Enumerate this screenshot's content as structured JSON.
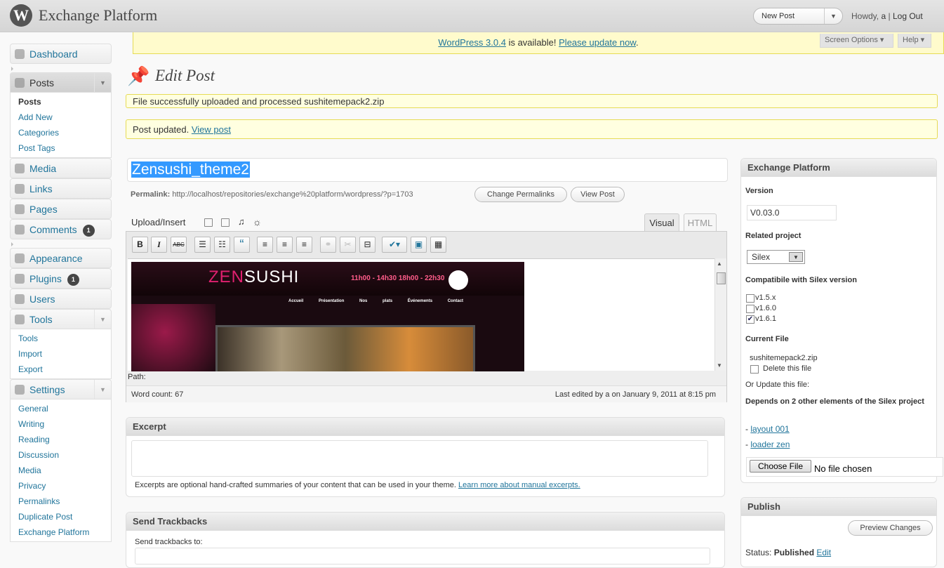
{
  "header": {
    "site_title": "Exchange Platform",
    "new_post": "New Post",
    "howdy_prefix": "Howdy,",
    "user": "a",
    "separator": "|",
    "logout": "Log Out"
  },
  "update_nag": {
    "version_link": "WordPress 3.0.4",
    "middle": "is available!",
    "update_link": "Please update now",
    "end": "."
  },
  "screen_options": "Screen Options",
  "help": "Help",
  "menu": {
    "dashboard": "Dashboard",
    "posts": "Posts",
    "posts_sub": [
      "Posts",
      "Add New",
      "Categories",
      "Post Tags"
    ],
    "media": "Media",
    "links": "Links",
    "pages": "Pages",
    "comments": "Comments",
    "comments_count": "1",
    "appearance": "Appearance",
    "plugins": "Plugins",
    "plugins_count": "1",
    "users": "Users",
    "tools": "Tools",
    "tools_sub": [
      "Tools",
      "Import",
      "Export"
    ],
    "settings": "Settings",
    "settings_sub": [
      "General",
      "Writing",
      "Reading",
      "Discussion",
      "Media",
      "Privacy",
      "Permalinks",
      "Duplicate Post",
      "Exchange Platform"
    ]
  },
  "page_title": "Edit Post",
  "notices": {
    "upload": "File successfully uploaded and processed sushitemepack2.zip",
    "updated": "Post updated.",
    "view_post": "View post"
  },
  "post": {
    "title": "Zensushi_theme2",
    "permalink_label": "Permalink:",
    "permalink_url": "http://localhost/repositories/exchange%20platform/wordpress/?p=1703",
    "change_permalinks": "Change Permalinks",
    "view_post": "View Post"
  },
  "editor": {
    "upload_insert": "Upload/Insert",
    "tab_visual": "Visual",
    "tab_html": "HTML",
    "path": "Path:",
    "word_count": "Word count: 67",
    "last_edited": "Last edited by a on January 9, 2011 at 8:15 pm",
    "toolbar": {
      "bold": "B",
      "italic": "I",
      "strike": "ABC",
      "quote": "“"
    }
  },
  "embedded_image": {
    "logo_a": "ZEN",
    "logo_b": "SUSHI",
    "hours": "11h00 - 14h30   18h00 - 22h30",
    "nav": "Accueil Présentation Nos plats Événements Contact"
  },
  "excerpt": {
    "title": "Excerpt",
    "desc": "Excerpts are optional hand-crafted summaries of your content that can be used in your theme.",
    "link": "Learn more about manual excerpts."
  },
  "trackbacks": {
    "title": "Send Trackbacks",
    "label": "Send trackbacks to:"
  },
  "exchange": {
    "title": "Exchange Platform",
    "version_label": "Version",
    "version_value": "V0.03.0",
    "related_label": "Related project",
    "related_value": "Silex",
    "compat_label": "Compatibile with Silex version",
    "versions": [
      "v1.5.x",
      "v1.6.0",
      "v1.6.1"
    ],
    "current_file_label": "Current File",
    "current_file": "sushitemepack2.zip",
    "delete_file": "Delete this file",
    "or_update": "Or Update this file:",
    "depends": "Depends on 2 other elements of the Silex project",
    "dep1_prefix": "-",
    "dep1": "layout 001",
    "dep2_prefix": "-",
    "dep2": "loader zen",
    "choose_file": "Choose File",
    "no_file": "No file chosen"
  },
  "publish": {
    "title": "Publish",
    "preview": "Preview Changes",
    "status_label": "Status:",
    "status_value": "Published",
    "edit": "Edit"
  },
  "colors": {
    "link": "#21759b",
    "notice_bg": "#ffffe0",
    "notice_border": "#e6db55",
    "selection": "#3399ff"
  }
}
